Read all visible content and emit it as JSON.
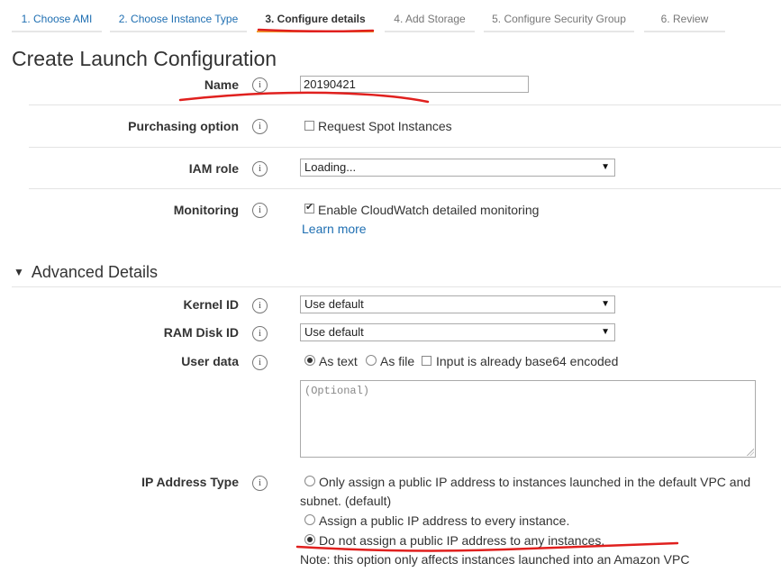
{
  "tabs": [
    {
      "label": "1. Choose AMI"
    },
    {
      "label": "2. Choose Instance Type"
    },
    {
      "label": "3. Configure details"
    },
    {
      "label": "4. Add Storage"
    },
    {
      "label": "5. Configure Security Group"
    },
    {
      "label": "6. Review"
    }
  ],
  "page_title": "Create Launch Configuration",
  "info_glyph": "i",
  "name_field": {
    "label": "Name",
    "value": "20190421"
  },
  "purchasing": {
    "label": "Purchasing option",
    "checkbox_label": "Request Spot Instances",
    "checked": false
  },
  "iam_role": {
    "label": "IAM role",
    "value": "Loading..."
  },
  "monitoring": {
    "label": "Monitoring",
    "checkbox_label": "Enable CloudWatch detailed monitoring",
    "checked": true,
    "learn_more": "Learn more"
  },
  "advanced": {
    "title": "Advanced Details",
    "kernel": {
      "label": "Kernel ID",
      "value": "Use default"
    },
    "ramdisk": {
      "label": "RAM Disk ID",
      "value": "Use default"
    },
    "user_data": {
      "label": "User data",
      "opt_text": "As text",
      "opt_file": "As file",
      "base64_label": "Input is already base64 encoded",
      "placeholder": "(Optional)"
    },
    "ip_type": {
      "label": "IP Address Type",
      "option1_line1": "Only assign a public IP address to instances launched in the default VPC and",
      "option1_line2": "subnet. (default)",
      "option2": "Assign a public IP address to every instance.",
      "option3": "Do not assign a public IP address to any instances.",
      "note": "Note: this option only affects instances launched into an Amazon VPC"
    }
  },
  "colors": {
    "link": "#1f6fb2",
    "active_tab": "#f0a030",
    "annotation": "#e0201e"
  }
}
